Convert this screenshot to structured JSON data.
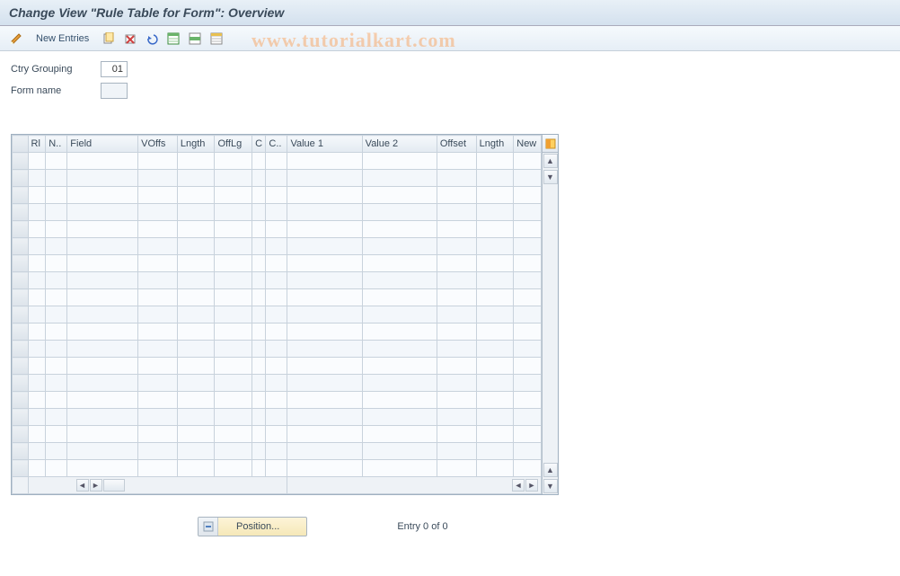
{
  "title": "Change View \"Rule Table for Form\": Overview",
  "toolbar": {
    "new_entries": "New Entries"
  },
  "form": {
    "ctry_grouping_label": "Ctry Grouping",
    "ctry_grouping_value": "01",
    "form_name_label": "Form name",
    "form_name_value": ""
  },
  "table": {
    "columns": [
      "",
      "Rl",
      "N..",
      "Field",
      "VOffs",
      "Lngth",
      "OffLg",
      "C",
      "C..",
      "Value 1",
      "Value 2",
      "Offset",
      "Lngth",
      "New"
    ],
    "row_count": 19
  },
  "footer": {
    "position_label": "Position...",
    "entry_label": "Entry 0 of 0"
  },
  "watermark": "www.tutorialkart.com"
}
